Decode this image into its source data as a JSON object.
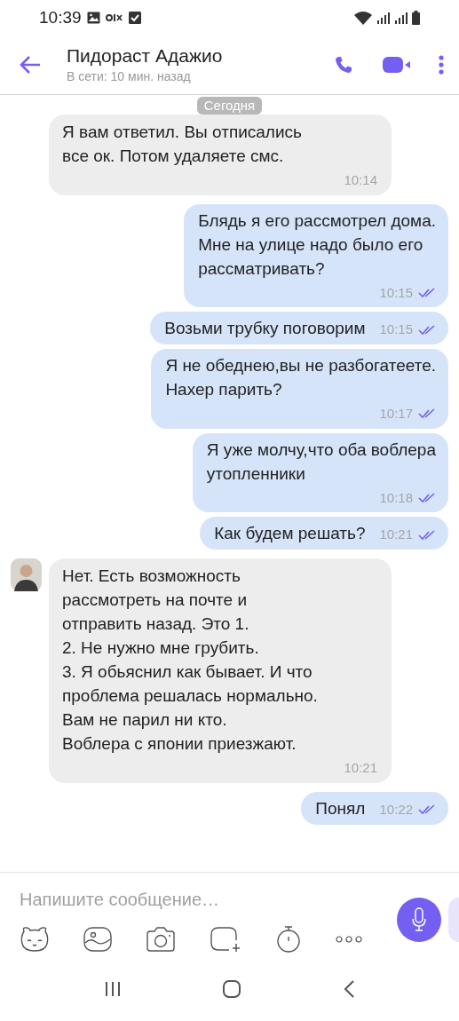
{
  "status_bar": {
    "time": "10:39"
  },
  "header": {
    "title": "Пидораст Адажио",
    "subtitle": "В сети: 10 мин. назад"
  },
  "date_chip": "Сегодня",
  "messages": [
    {
      "kind": "incoming",
      "lines": [
        "Я вам ответил. Вы отписались",
        "все ок. Потом удаляете смс."
      ],
      "time": "10:14"
    },
    {
      "kind": "outgoing",
      "lines": [
        "Блядь я его рассмотрел дома.",
        "Мне на улице надо было его",
        "рассматривать?"
      ],
      "time": "10:15",
      "read": true
    },
    {
      "kind": "outgoing",
      "lines": [
        "Возьми трубку поговорим"
      ],
      "time": "10:15",
      "read": true
    },
    {
      "kind": "outgoing",
      "lines": [
        "Я не обеднею,вы не разбогатеете.",
        "Нахер парить?"
      ],
      "time": "10:17",
      "read": true
    },
    {
      "kind": "outgoing",
      "lines": [
        "Я уже молчу,что оба воблера",
        "утопленники"
      ],
      "time": "10:18",
      "read": true
    },
    {
      "kind": "outgoing",
      "lines": [
        "Как будем решать?"
      ],
      "time": "10:21",
      "read": true
    },
    {
      "kind": "incoming",
      "lines": [
        "Нет. Есть возможность",
        "рассмотреть на почте и",
        "отправить назад. Это 1.",
        "2. Не нужно мне грубить.",
        "3. Я обьяснил как бывает. И что",
        "проблема решалась нормально.",
        "Вам не парил ни кто.",
        "Воблера с японии приезжают."
      ],
      "time": "10:21"
    },
    {
      "kind": "outgoing",
      "lines": [
        "Понял"
      ],
      "time": "10:22",
      "read": true
    }
  ],
  "composer": {
    "placeholder": "Напишите сообщение…"
  }
}
